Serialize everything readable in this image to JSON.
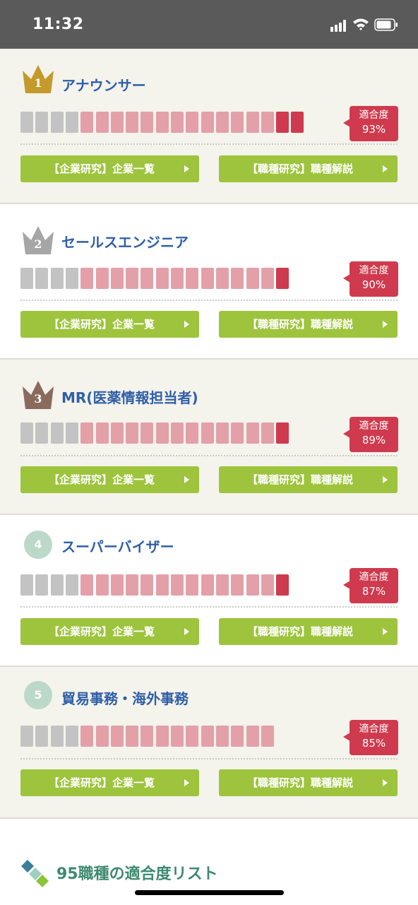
{
  "status_bar": {
    "time": "11:32"
  },
  "jobs": [
    {
      "rank": "1",
      "title": "アナウンサー",
      "fit_label": "適合度",
      "fit_percent": "93%",
      "bar": {
        "grey": 4,
        "pink": 13,
        "red": 2
      },
      "crown_color": "#c49a2c",
      "company_button": "【企業研究】企業一覧",
      "job_button": "【職種研究】職種解説"
    },
    {
      "rank": "2",
      "title": "セールスエンジニア",
      "fit_label": "適合度",
      "fit_percent": "90%",
      "bar": {
        "grey": 4,
        "pink": 13,
        "red": 1
      },
      "crown_color": "#a6a6a6",
      "company_button": "【企業研究】企業一覧",
      "job_button": "【職種研究】職種解説"
    },
    {
      "rank": "3",
      "title": "MR(医薬情報担当者)",
      "fit_label": "適合度",
      "fit_percent": "89%",
      "bar": {
        "grey": 4,
        "pink": 13,
        "red": 1
      },
      "crown_color": "#8a6a5c",
      "company_button": "【企業研究】企業一覧",
      "job_button": "【職種研究】職種解説"
    },
    {
      "rank": "4",
      "title": "スーパーバイザー",
      "fit_label": "適合度",
      "fit_percent": "87%",
      "bar": {
        "grey": 4,
        "pink": 13,
        "red": 1
      },
      "company_button": "【企業研究】企業一覧",
      "job_button": "【職種研究】職種解説"
    },
    {
      "rank": "5",
      "title": "貿易事務・海外事務",
      "fit_label": "適合度",
      "fit_percent": "85%",
      "bar": {
        "grey": 4,
        "pink": 13,
        "red": 0
      },
      "company_button": "【企業研究】企業一覧",
      "job_button": "【職種研究】職種解説"
    }
  ],
  "list_section": {
    "title": "95職種の適合度リスト"
  },
  "colors": {
    "accent_red": "#cf3a4e",
    "button_green": "#9dc43c",
    "title_blue": "#2f5fa8",
    "list_green": "#3d8a6f"
  }
}
